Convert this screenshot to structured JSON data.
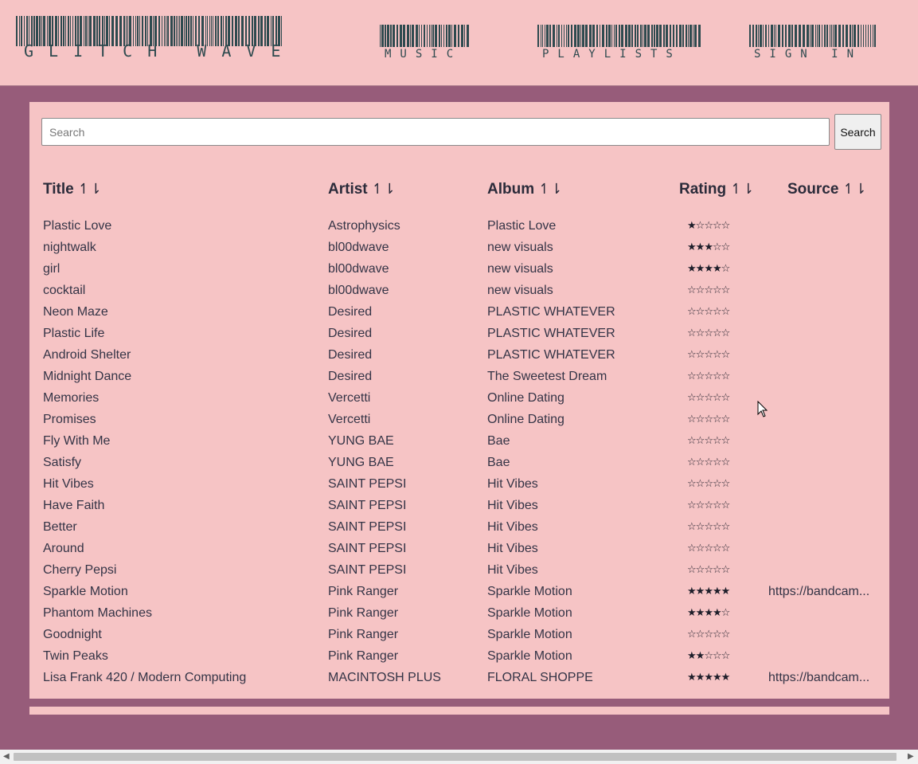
{
  "header": {
    "logo_text": "GLITCH WAVE",
    "nav": {
      "music": "MUSIC",
      "playlists": "PLAYLISTS",
      "sign_in": "SIGN IN"
    }
  },
  "search": {
    "placeholder": "Search",
    "value": "",
    "button_label": "Search"
  },
  "table": {
    "columns": [
      {
        "label": "Title",
        "sort_icon": "↿⇂"
      },
      {
        "label": "Artist",
        "sort_icon": "↿⇂"
      },
      {
        "label": "Album",
        "sort_icon": "↿⇂"
      },
      {
        "label": "Rating",
        "sort_icon": "↿⇂"
      },
      {
        "label": "Source",
        "sort_icon": "↿⇂"
      }
    ],
    "rows": [
      {
        "title": "Plastic Love",
        "artist": "Astrophysics",
        "album": "Plastic Love",
        "rating": 1,
        "source": ""
      },
      {
        "title": "nightwalk",
        "artist": "bl00dwave",
        "album": "new visuals",
        "rating": 3,
        "source": ""
      },
      {
        "title": "girl",
        "artist": "bl00dwave",
        "album": "new visuals",
        "rating": 4,
        "source": ""
      },
      {
        "title": "cocktail",
        "artist": "bl00dwave",
        "album": "new visuals",
        "rating": 0,
        "source": ""
      },
      {
        "title": "Neon Maze",
        "artist": "Desired",
        "album": "PLASTIC WHATEVER",
        "rating": 0,
        "source": ""
      },
      {
        "title": "Plastic Life",
        "artist": "Desired",
        "album": "PLASTIC WHATEVER",
        "rating": 0,
        "source": ""
      },
      {
        "title": "Android Shelter",
        "artist": "Desired",
        "album": "PLASTIC WHATEVER",
        "rating": 0,
        "source": ""
      },
      {
        "title": "Midnight Dance",
        "artist": "Desired",
        "album": "The Sweetest Dream",
        "rating": 0,
        "source": ""
      },
      {
        "title": "Memories",
        "artist": "Vercetti",
        "album": "Online Dating",
        "rating": 0,
        "source": ""
      },
      {
        "title": "Promises",
        "artist": "Vercetti",
        "album": "Online Dating",
        "rating": 0,
        "source": ""
      },
      {
        "title": "Fly With Me",
        "artist": "YUNG BAE",
        "album": "Bae",
        "rating": 0,
        "source": ""
      },
      {
        "title": "Satisfy",
        "artist": "YUNG BAE",
        "album": "Bae",
        "rating": 0,
        "source": ""
      },
      {
        "title": "Hit Vibes",
        "artist": "SAINT PEPSI",
        "album": "Hit Vibes",
        "rating": 0,
        "source": ""
      },
      {
        "title": "Have Faith",
        "artist": "SAINT PEPSI",
        "album": "Hit Vibes",
        "rating": 0,
        "source": ""
      },
      {
        "title": "Better",
        "artist": "SAINT PEPSI",
        "album": "Hit Vibes",
        "rating": 0,
        "source": ""
      },
      {
        "title": "Around",
        "artist": "SAINT PEPSI",
        "album": "Hit Vibes",
        "rating": 0,
        "source": ""
      },
      {
        "title": "Cherry Pepsi",
        "artist": "SAINT PEPSI",
        "album": "Hit Vibes",
        "rating": 0,
        "source": ""
      },
      {
        "title": "Sparkle Motion",
        "artist": "Pink Ranger",
        "album": "Sparkle Motion",
        "rating": 5,
        "source": "https://bandcam..."
      },
      {
        "title": "Phantom Machines",
        "artist": "Pink Ranger",
        "album": "Sparkle Motion",
        "rating": 4,
        "source": ""
      },
      {
        "title": "Goodnight",
        "artist": "Pink Ranger",
        "album": "Sparkle Motion",
        "rating": 0,
        "source": ""
      },
      {
        "title": "Twin Peaks",
        "artist": "Pink Ranger",
        "album": "Sparkle Motion",
        "rating": 2,
        "source": ""
      },
      {
        "title": "Lisa Frank 420 / Modern Computing",
        "artist": "MACINTOSH PLUS",
        "album": "FLORAL SHOPPE",
        "rating": 5,
        "source": "https://bandcam..."
      }
    ]
  },
  "colors": {
    "page_background": "#975c7a",
    "panel_background": "#f6c4c5",
    "barcode": "#2e4a4f",
    "text": "#343446"
  },
  "icons": {
    "sort": "sort-arrows-icon",
    "star_filled": "star-filled-icon",
    "star_empty": "star-empty-icon",
    "cursor": "mouse-pointer-icon"
  }
}
